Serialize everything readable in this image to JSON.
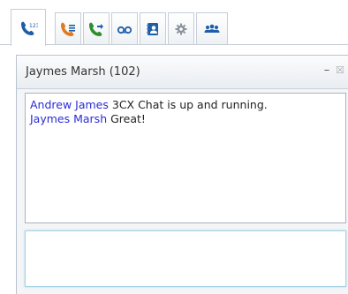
{
  "tabs": [
    {
      "name": "chat-tab",
      "icon": "phone-chat-icon",
      "active": true
    },
    {
      "name": "calls-tab",
      "icon": "phone-list-icon",
      "active": false
    },
    {
      "name": "call-forward-tab",
      "icon": "phone-forward-icon",
      "active": false
    },
    {
      "name": "voicemail-tab",
      "icon": "voicemail-icon",
      "active": false
    },
    {
      "name": "contacts-tab",
      "icon": "contacts-book-icon",
      "active": false
    },
    {
      "name": "settings-tab",
      "icon": "gear-icon",
      "active": false
    },
    {
      "name": "presence-tab",
      "icon": "users-group-icon",
      "active": false
    }
  ],
  "chat": {
    "title": "Jaymes Marsh (102)",
    "minimize_label": "–",
    "close_label": "☒",
    "messages": [
      {
        "sender": "Andrew James",
        "text": " 3CX Chat is up and running."
      },
      {
        "sender": "Jaymes Marsh",
        "text": " Great!"
      }
    ],
    "input_value": ""
  },
  "colors": {
    "sender": "#2b2bd8",
    "phone_icon": "#1e5ea8",
    "phone_orange": "#e07a20",
    "phone_green": "#2f8f2f"
  }
}
